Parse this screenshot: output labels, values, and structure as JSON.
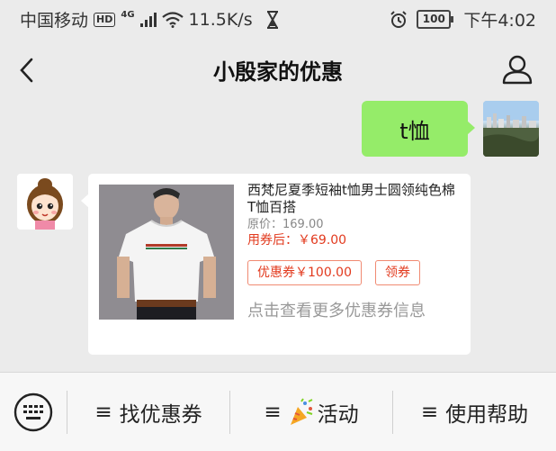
{
  "status_bar": {
    "carrier": "中国移动",
    "hd": "HD",
    "signal_type": "4G",
    "speed": "11.5K/s",
    "battery": "100",
    "time": "下午4:02"
  },
  "header": {
    "title": "小殷家的优惠",
    "back_icon": "back-chevron-icon",
    "profile_icon": "person-icon"
  },
  "messages": {
    "outgoing_text": "t恤"
  },
  "product_card": {
    "title": "西梵尼夏季短袖t恤男士圆领纯色棉T恤百搭",
    "original_price": "原价：169.00",
    "coupon_price": "用券后：￥69.00",
    "coupon_label": "优惠券￥100.00",
    "claim_label": "领券",
    "more_coupons": "点击查看更多优惠券信息"
  },
  "bottom_menu": {
    "keyboard_icon": "keyboard-icon",
    "items": [
      {
        "glyph": "≡",
        "label": "找优惠券"
      },
      {
        "glyph": "≡",
        "label": "活动"
      },
      {
        "glyph": "≡",
        "label": "使用帮助"
      }
    ]
  },
  "colors": {
    "bubble_green": "#95ec69",
    "price_red": "#e23a1e",
    "background": "#ebebeb"
  }
}
